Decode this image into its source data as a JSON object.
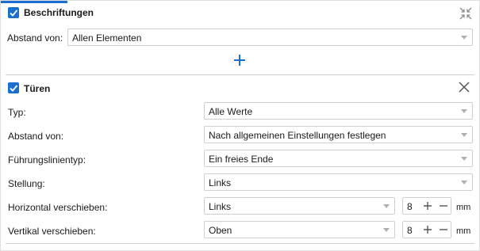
{
  "beschriftungen": {
    "title": "Beschriftungen",
    "checked": true,
    "abstand_label": "Abstand von:",
    "abstand_value": "Allen Elementen"
  },
  "tueren": {
    "title": "Türen",
    "checked": true,
    "rows": {
      "typ": {
        "label": "Typ:",
        "value": "Alle Werte"
      },
      "abstand": {
        "label": "Abstand von:",
        "value": "Nach allgemeinen Einstellungen festlegen"
      },
      "fuehrung": {
        "label": "Führungslinientyp:",
        "value": "Ein freies Ende"
      },
      "stellung": {
        "label": "Stellung:",
        "value": "Links"
      },
      "horizontal": {
        "label": "Horizontal verschieben:",
        "value": "Links",
        "amount": "8",
        "unit": "mm"
      },
      "vertikal": {
        "label": "Vertikal verschieben:",
        "value": "Oben",
        "amount": "8",
        "unit": "mm"
      }
    }
  },
  "colors": {
    "accent": "#1a6fd1",
    "border": "#cfcfcf",
    "icon_gray": "#8a8a8a"
  },
  "icons": {
    "collapse": "collapse-arrows-icon",
    "add": "plus-icon",
    "close": "close-icon",
    "chevron": "chevron-down-icon",
    "check": "checkmark-icon"
  }
}
